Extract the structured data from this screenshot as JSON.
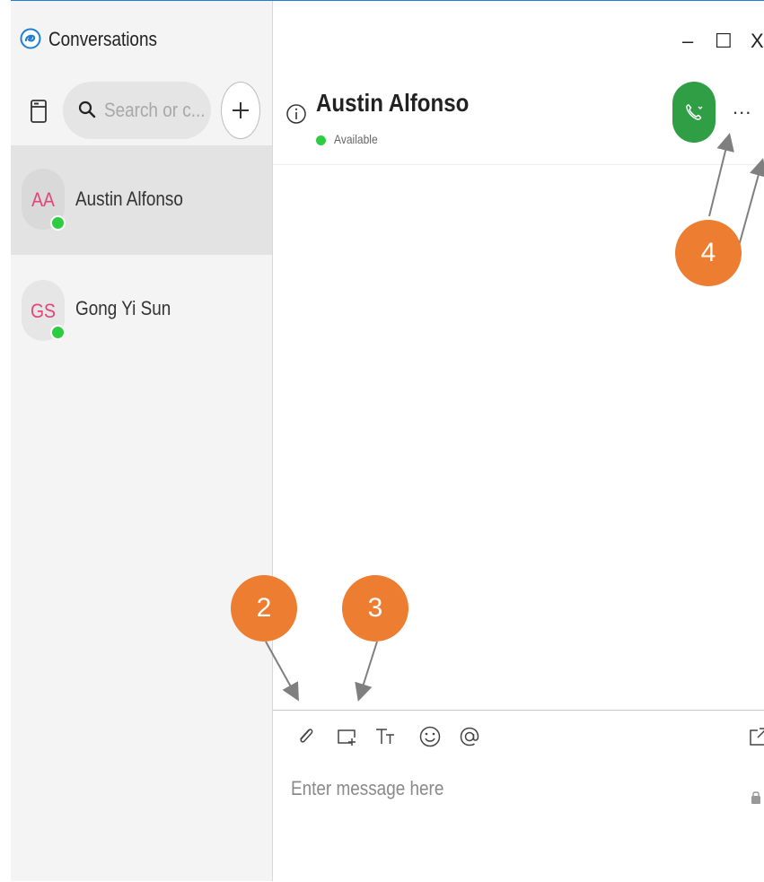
{
  "app": {
    "title": "Conversations"
  },
  "window_controls": {
    "minimize": "–",
    "maximize": "☐",
    "close": "X"
  },
  "sidebar": {
    "search": {
      "placeholder": "Search or c..."
    },
    "add_label": "+",
    "conversations": [
      {
        "initials": "AA",
        "name": "Austin Alfonso",
        "status": "available",
        "selected": true
      },
      {
        "initials": "GS",
        "name": "Gong Yi Sun",
        "status": "available",
        "selected": false
      }
    ]
  },
  "chat": {
    "contact_name": "Austin Alfonso",
    "status_text": "Available",
    "more_label": "...",
    "compose": {
      "placeholder": "Enter message here"
    }
  },
  "annotations": {
    "callout_2": "2",
    "callout_3": "3",
    "callout_4": "4"
  },
  "colors": {
    "accent_blue": "#1f7fd1",
    "presence_green": "#2ecc40",
    "call_green": "#2f9e44",
    "callout_orange": "#ed7d31",
    "initials_pink": "#e0457b"
  }
}
